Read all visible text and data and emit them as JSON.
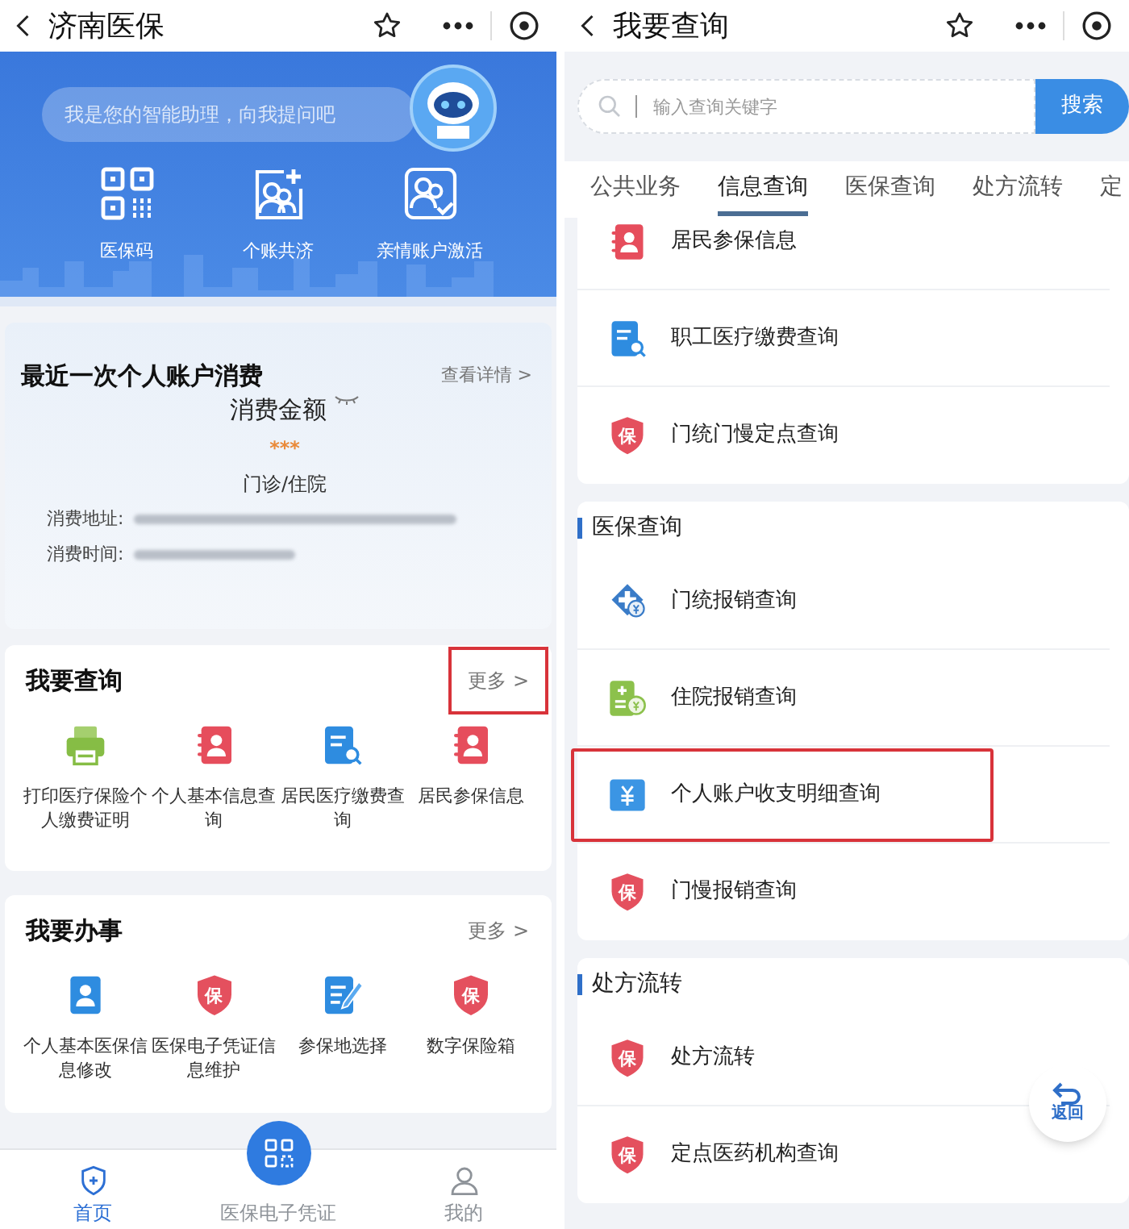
{
  "left_screen": {
    "title": "济南医保",
    "assistant_search": {
      "placeholder": "我是您的智能助理，向我提问吧"
    },
    "quick_actions": [
      {
        "kind": "qr",
        "label": "医保码"
      },
      {
        "kind": "people-plus",
        "label": "个账共济"
      },
      {
        "kind": "people-check",
        "label": "亲情账户激活"
      }
    ],
    "last_spending": {
      "title": "最近一次个人账户消费",
      "link": "查看详情 >",
      "amount_label": "消费金额",
      "amount": "***",
      "type": "门诊/住院",
      "fields": [
        {
          "label": "消费地址:",
          "value_redacted": true
        },
        {
          "label": "消费时间:",
          "value_redacted": true
        }
      ]
    },
    "query_section": {
      "title": "我要查询",
      "more": "更多 >",
      "more_highlighted": true,
      "items": [
        {
          "kind": "printer",
          "label": "打印医疗保险个人缴费证明"
        },
        {
          "kind": "contact-book",
          "label": "个人基本信息查询"
        },
        {
          "kind": "doc-search",
          "label": "居民医疗缴费查询"
        },
        {
          "kind": "contact-book",
          "label": "居民参保信息"
        }
      ]
    },
    "tasks_section": {
      "title": "我要办事",
      "more": "更多 >",
      "more_highlighted": false,
      "items": [
        {
          "kind": "profile-card",
          "label": "个人基本医保信息修改"
        },
        {
          "kind": "shield",
          "glyph": "保",
          "label": "医保电子凭证信息维护"
        },
        {
          "kind": "doc-pen",
          "label": "参保地选择"
        },
        {
          "kind": "shield",
          "glyph": "保",
          "label": "数字保险箱"
        }
      ]
    },
    "bottom_nav": [
      {
        "kind": "home",
        "label": "首页",
        "selected": true
      },
      {
        "kind": "center",
        "label": "医保电子凭证",
        "selected": false
      },
      {
        "kind": "person",
        "label": "我的",
        "selected": false
      }
    ]
  },
  "right_screen": {
    "title": "我要查询",
    "search": {
      "placeholder": "输入查询关键字",
      "button": "搜索"
    },
    "tabs": [
      {
        "label": "公共业务",
        "selected": false
      },
      {
        "label": "信息查询",
        "selected": true
      },
      {
        "label": "医保查询",
        "selected": false
      },
      {
        "label": "处方流转",
        "selected": false
      },
      {
        "label": "定",
        "selected": false
      }
    ],
    "sections": [
      {
        "items": [
          {
            "kind": "contact-book",
            "label": "居民参保信息",
            "highlighted": false
          },
          {
            "kind": "doc-search",
            "label": "职工医疗缴费查询",
            "highlighted": false
          },
          {
            "kind": "shield",
            "glyph": "保",
            "label": "门统门慢定点查询",
            "highlighted": false
          }
        ]
      },
      {
        "title": "医保查询",
        "items": [
          {
            "kind": "plus-yen",
            "label": "门统报销查询",
            "highlighted": false
          },
          {
            "kind": "bill-yen",
            "label": "住院报销查询",
            "highlighted": false
          },
          {
            "kind": "yen-square",
            "label": "个人账户收支明细查询",
            "highlighted": true
          },
          {
            "kind": "shield",
            "glyph": "保",
            "label": "门慢报销查询",
            "highlighted": false
          }
        ]
      },
      {
        "title": "处方流转",
        "items": [
          {
            "kind": "shield",
            "glyph": "保",
            "label": "处方流转",
            "highlighted": false
          },
          {
            "kind": "shield",
            "glyph": "保",
            "label": "定点医药机构查询",
            "highlighted": false
          }
        ]
      }
    ],
    "back_button": {
      "label": "返回"
    }
  }
}
